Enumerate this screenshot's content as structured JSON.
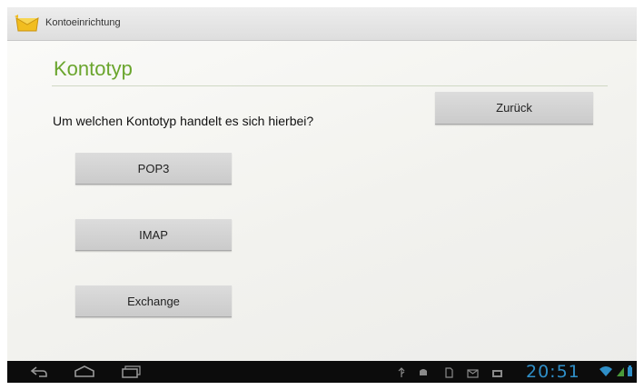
{
  "action_bar": {
    "title": "Kontoeinrichtung",
    "app_icon": "mail-envelope-icon"
  },
  "page": {
    "title": "Kontotyp",
    "question": "Um welchen Kontotyp handelt es sich hierbei?"
  },
  "buttons": {
    "back": "Zurück",
    "pop3": "POP3",
    "imap": "IMAP",
    "exchange": "Exchange"
  },
  "system_bar": {
    "nav_icons": [
      "back-icon",
      "home-icon",
      "recent-apps-icon"
    ],
    "status_icons": [
      "usb-icon",
      "android-debug-icon",
      "sd-card-icon",
      "email-notification-icon",
      "screenshot-icon"
    ],
    "clock": "20:51",
    "wifi_icon": "wifi-icon",
    "battery_icon": "battery-icon",
    "clock_color": "#2f8fc8"
  },
  "colors": {
    "title_green": "#6aa52d",
    "button_gray": "#d4d4d4",
    "system_bar": "#0c0c0c"
  }
}
